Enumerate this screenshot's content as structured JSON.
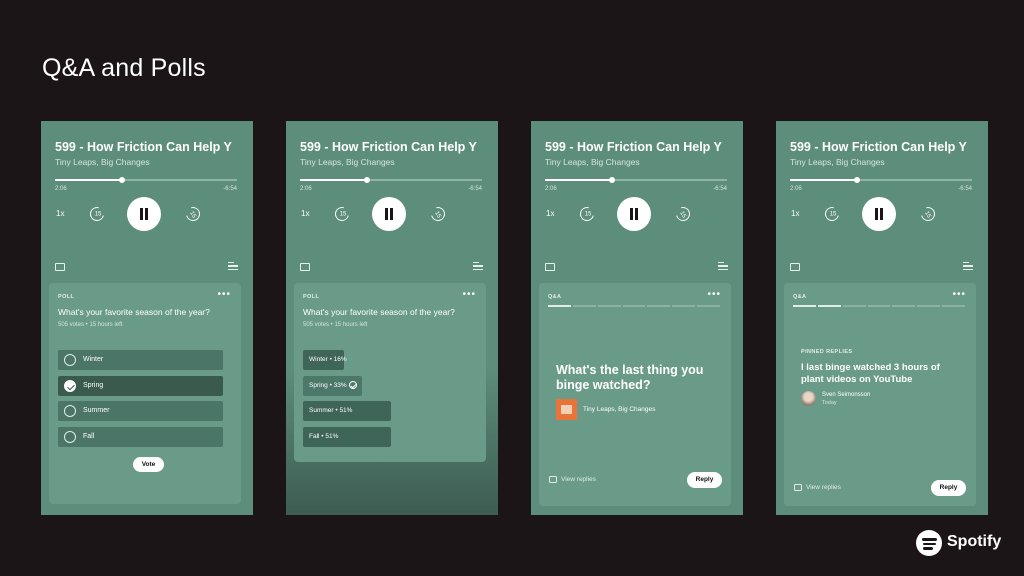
{
  "slide_title": "Q&A and Polls",
  "colors": {
    "background": "#1c1517",
    "phone": "#5d8e7c",
    "card": "#6a9b89"
  },
  "player": {
    "episode_title": "599 - How Friction Can Help Y",
    "show_name": "Tiny Leaps, Big Changes",
    "elapsed": "2:06",
    "remaining": "-6:54",
    "progress": 0.37,
    "speed": "1x",
    "skip_back": "15",
    "skip_forward": "15"
  },
  "poll": {
    "label": "POLL",
    "more": "•••",
    "question": "What's your favorite season of the year?",
    "meta": "505 votes • 15 hours left",
    "options": [
      "Winter",
      "Spring",
      "Summer",
      "Fall"
    ],
    "selected": "Spring",
    "vote_label": "Vote"
  },
  "poll_results": {
    "label": "POLL",
    "more": "•••",
    "question": "What's your favorite season of the year?",
    "meta": "505 votes • 15 hours left",
    "results": [
      {
        "text": "Winter • 16%",
        "percent": 16
      },
      {
        "text": "Spring • 33%",
        "percent": 33
      },
      {
        "text": "Summer • 51%",
        "percent": 51
      },
      {
        "text": "Fall • 51%",
        "percent": 51
      }
    ]
  },
  "qa": {
    "label": "Q&A",
    "more": "•••",
    "question": "What's the last thing you binge watched?",
    "show_name": "Tiny Leaps, Big Changes",
    "view_replies": "View replies",
    "reply_label": "Reply"
  },
  "qa_pinned": {
    "label": "Q&A",
    "more": "•••",
    "pinned_label": "PINNED REPLIES",
    "pinned_text": "I last binge watched 3 hours of plant videos on YouTube",
    "user_name": "Sven Seimonsson",
    "user_time": "Today",
    "view_replies": "View replies",
    "reply_label": "Reply"
  },
  "brand": {
    "name": "Spotify"
  }
}
